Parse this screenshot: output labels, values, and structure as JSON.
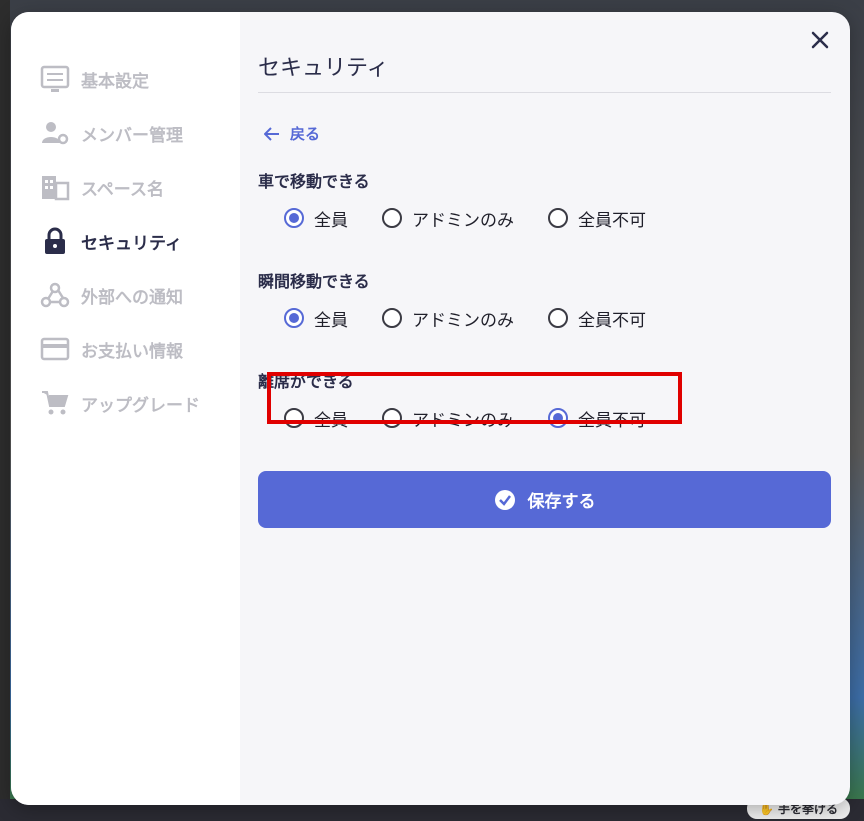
{
  "sidebar": {
    "items": [
      {
        "label": "基本設定",
        "icon": "settings-panel-icon",
        "active": false
      },
      {
        "label": "メンバー管理",
        "icon": "member-gear-icon",
        "active": false
      },
      {
        "label": "スペース名",
        "icon": "building-icon",
        "active": false
      },
      {
        "label": "セキュリティ",
        "icon": "lock-icon",
        "active": true
      },
      {
        "label": "外部への通知",
        "icon": "webhook-icon",
        "active": false
      },
      {
        "label": "お支払い情報",
        "icon": "credit-card-icon",
        "active": false
      },
      {
        "label": "アップグレード",
        "icon": "cart-icon",
        "active": false
      }
    ]
  },
  "main": {
    "title": "セキュリティ",
    "back_label": "戻る",
    "sections": [
      {
        "label": "車で移動できる",
        "options": [
          "全員",
          "アドミンのみ",
          "全員不可"
        ],
        "selected": 0
      },
      {
        "label": "瞬間移動できる",
        "options": [
          "全員",
          "アドミンのみ",
          "全員不可"
        ],
        "selected": 0
      },
      {
        "label": "離席ができる",
        "options": [
          "全員",
          "アドミンのみ",
          "全員不可"
        ],
        "selected": 2
      }
    ],
    "save_label": "保存する"
  },
  "background": {
    "raise_hand_label": "手を挙げる"
  },
  "colors": {
    "accent": "#5669d6",
    "highlight": "#e00000",
    "text_dark": "#2b2d4a",
    "text_muted": "#bdbdc4"
  }
}
